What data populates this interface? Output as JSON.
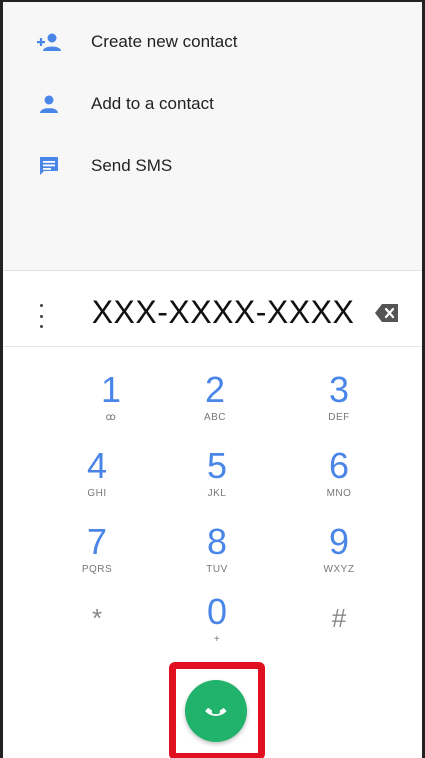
{
  "actions": [
    {
      "label": "Create new contact",
      "icon": "person-add-icon"
    },
    {
      "label": "Add to a contact",
      "icon": "person-icon"
    },
    {
      "label": "Send SMS",
      "icon": "message-icon"
    }
  ],
  "dialer": {
    "number": "XXX-XXXX-XXXX",
    "keys": [
      {
        "digit": "1",
        "letters": "ꝏ"
      },
      {
        "digit": "2",
        "letters": "ABC"
      },
      {
        "digit": "3",
        "letters": "DEF"
      },
      {
        "digit": "4",
        "letters": "GHI"
      },
      {
        "digit": "5",
        "letters": "JKL"
      },
      {
        "digit": "6",
        "letters": "MNO"
      },
      {
        "digit": "7",
        "letters": "PQRS"
      },
      {
        "digit": "8",
        "letters": "TUV"
      },
      {
        "digit": "9",
        "letters": "WXYZ"
      },
      {
        "digit": "*",
        "letters": ""
      },
      {
        "digit": "0",
        "letters": "+"
      },
      {
        "digit": "#",
        "letters": ""
      }
    ]
  },
  "colors": {
    "accent": "#4a86e8",
    "call_button": "#21b36b",
    "highlight": "#e01020"
  }
}
